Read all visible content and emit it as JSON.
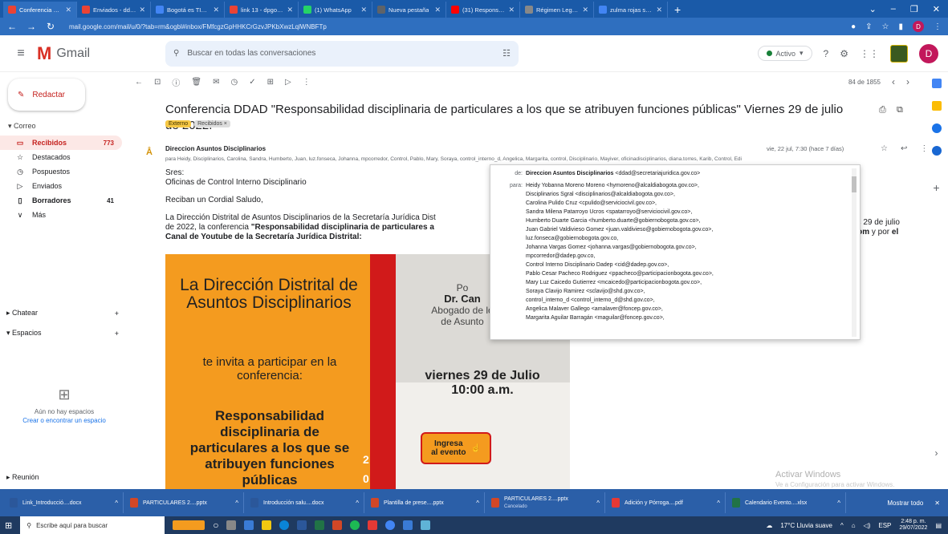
{
  "browser": {
    "tabs": [
      {
        "label": "Conferencia DDAD \"Re",
        "color": "#ea4335",
        "active": true
      },
      {
        "label": "Enviados - ddad@sec",
        "color": "#ea4335"
      },
      {
        "label": "Bogotá es TIC - Calen",
        "color": "#4285f4"
      },
      {
        "label": "link 13 - dpgomezm@",
        "color": "#ea4335"
      },
      {
        "label": "(1) WhatsApp",
        "color": "#25d366"
      },
      {
        "label": "Nueva pestaña",
        "color": "#5f6368"
      },
      {
        "label": "(31) Responsabilidad",
        "color": "#ff0000"
      },
      {
        "label": "Régimen Legal de Bo",
        "color": "#888888"
      },
      {
        "label": "zulma rojas secretaria",
        "color": "#4285f4"
      }
    ],
    "url": "mail.google.com/mail/u/0/?tab=rm&ogbl#inbox/FMfcgzGpHHKCrGzvJPKbXwzLqlWNBFTp",
    "profile_initial": "D"
  },
  "gmail": {
    "product": "Gmail",
    "search_placeholder": "Buscar en todas las conversaciones",
    "status": "Activo",
    "avatar_initial": "D"
  },
  "nav": {
    "compose": "Redactar",
    "section_mail": "Correo",
    "items": [
      {
        "label": "Recibidos",
        "count": "773",
        "icon": "▭"
      },
      {
        "label": "Destacados",
        "count": "",
        "icon": "☆"
      },
      {
        "label": "Pospuestos",
        "count": "",
        "icon": "◷"
      },
      {
        "label": "Enviados",
        "count": "",
        "icon": "▷"
      },
      {
        "label": "Borradores",
        "count": "41",
        "icon": "▯"
      },
      {
        "label": "Más",
        "count": "",
        "icon": "∨"
      }
    ],
    "chat": "Chatear",
    "spaces": "Espacios",
    "no_spaces": "Aún no hay espacios",
    "find_space": "Crear o encontrar un espacio",
    "meeting": "Reunión"
  },
  "toolbar": {
    "position": "84 de 1855"
  },
  "message": {
    "subject": "Conferencia DDAD \"Responsabilidad disciplinaria de particulares a los que se atribuyen funciones públicas\" Viernes 29 de julio de 2022.",
    "label_external": "Externo",
    "label_inbox": "Recibidos ×",
    "sender": "Direccion Asuntos Disciplinarios",
    "recipients": "para Heidy, Disciplinarios, Carolina, Sandra, Humberto, Juan, luz.fonseca, Johanna, mpcorredor, Control, Pablo, Mary, Soraya, control_interno_d, Angelica, Margarita, control, Disciplinario, Mayiver, oficinadisciplinarios, diana.torres, Karib, Control, Edi",
    "date": "vie, 22 jul, 7:30 (hace 7 días)",
    "greeting1": "Sres:",
    "greeting2": "Oficinas de Control Interno Disciplinario",
    "salute": "Reciban un Cordial Saludo,",
    "intro_a": "La Dirección Distrital de Asuntos Disciplinarios de la Secretaría Jurídica Dist",
    "intro_b": "de 2022, la conferencia ",
    "intro_c": "\"Responsabilidad disciplinaria de particulares a",
    "intro_d": "Canal de Youtube de la Secretaría Jurídica Distrital:",
    "intro_right1": "es 29 de julio",
    "intro_right2": "oom",
    "intro_right3": " y por ",
    "intro_right4": "el"
  },
  "banner": {
    "line1": "La Dirección Distrital de Asuntos Disciplinarios",
    "line2": "te invita a participar en la conferencia:",
    "line3": "Responsabilidad disciplinaria de particulares a los que se atribuyen funciones públicas",
    "speaker_prefix": "Po",
    "speaker_name": "Dr. Can",
    "speaker_role1": "Abogado de lo",
    "speaker_role2": "de Asunto",
    "date": "viernes  29 de Julio",
    "time": "10:00 a.m.",
    "button": "Ingresa al evento",
    "num1": "2",
    "num2": "0"
  },
  "popup": {
    "from_label": "de:",
    "from_name": "Direccion Asuntos Disciplinarios",
    "from_email": "<ddad@secretariajuridica.gov.co>",
    "to_label": "para:",
    "recipients": [
      "Heidy Yobanna Moreno Moreno <hymoreno@alcaldiabogota.gov.co>,",
      "Disciplinarios Sgral <disciplinarios@alcaldiabogota.gov.co>,",
      "Carolina Pulido Cruz <cpulido@serviciocivil.gov.co>,",
      "Sandra Milena Patarroyo Ucros <spatarroyo@serviciocivil.gov.co>,",
      "Humberto Duarte Garcia <humberto.duarte@gobiernobogota.gov.co>,",
      "Juan Gabriel Valdivieso Gomez <juan.valdivieso@gobiernobogota.gov.co>,",
      "luz.fonseca@gobiernobogota.gov.co,",
      "Johanna Vargas Gomez <johanna.vargas@gobiernobogota.gov.co>,",
      "mpcorredor@dadep.gov.co,",
      "Control Interno Disciplinario Dadep <cid@dadep.gov.co>,",
      "Pablo Cesar Pacheco Rodriguez <ppacheco@participacionbogota.gov.co>,",
      "Mary Luz Caicedo Gutierrez <mcaicedo@participacionbogota.gov.co>,",
      "Soraya Clavijo Ramirez <sclavijo@shd.gov.co>,",
      "control_interno_d <control_interno_d@shd.gov.co>,",
      "Angelica Malaver Gallego <amalaver@foncep.gov.co>,",
      "Margarita Aguilar Barragán <maguilar@foncep.gov.co>,"
    ]
  },
  "watermark": {
    "line1": "Activar Windows",
    "line2": "Ve a Configuración para activar Windows."
  },
  "downloads": {
    "items": [
      {
        "name": "Link_Introducció....docx",
        "sub": "",
        "color": "#2b579a"
      },
      {
        "name": "PARTICULARES 2....pptx",
        "sub": "",
        "color": "#d24726"
      },
      {
        "name": "Introducción salu....docx",
        "sub": "",
        "color": "#2b579a"
      },
      {
        "name": "Plantilla de prese....pptx",
        "sub": "",
        "color": "#d24726"
      },
      {
        "name": "PARTICULARES 2....pptx",
        "sub": "Cancelado",
        "color": "#d24726"
      },
      {
        "name": "Adición y Pórroga....pdf",
        "sub": "",
        "color": "#e53935"
      },
      {
        "name": "Calendario Evento....xlsx",
        "sub": "",
        "color": "#217346"
      }
    ],
    "show_all": "Mostrar todo"
  },
  "taskbar": {
    "search": "Escribe aquí para buscar",
    "weather": "17°C  Lluvia suave",
    "lang": "ESP",
    "time": "2:48 p. m.",
    "date": "29/07/2022"
  }
}
